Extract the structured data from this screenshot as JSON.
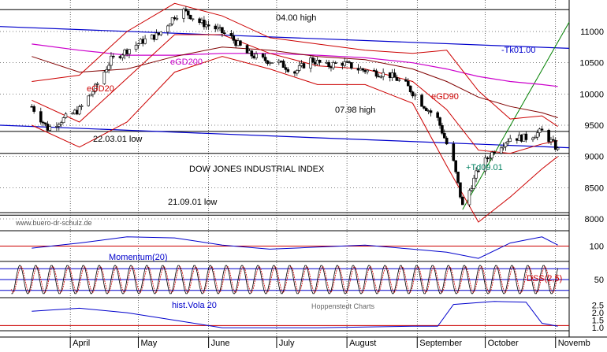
{
  "chart_data": {
    "type": "line",
    "title": "DOW JONES INDUSTRIAL INDEX",
    "watermark": "www.buero-dr-schulz.de",
    "source": "Hoppenstedt Charts",
    "x_labels": [
      "April",
      "May",
      "June",
      "July",
      "August",
      "September",
      "October",
      "Novemb"
    ],
    "price_panel": {
      "ylim": [
        7950,
        11400
      ],
      "yticks": [
        8000,
        8500,
        9000,
        9500,
        10000,
        10500,
        11000
      ],
      "horizontal_lines": [
        {
          "label": "04.00 high",
          "value": 11350
        },
        {
          "label": "07.98 high",
          "value": 9400
        },
        {
          "label": "22.03.01 low",
          "value": 9050
        },
        {
          "label": "21.09.01 low",
          "value": 8060
        }
      ],
      "overlay_labels": {
        "egd20": "eGD20",
        "egd200": "eGD200",
        "egd90": "eGD90",
        "tk": "-Tk01.00",
        "td": "+Td09.01"
      },
      "close": [
        {
          "d": "2001-03-15",
          "v": 9800
        },
        {
          "d": "2001-03-22",
          "v": 9450
        },
        {
          "d": "2001-03-29",
          "v": 9600
        },
        {
          "d": "2001-04-05",
          "v": 9750
        },
        {
          "d": "2001-04-12",
          "v": 10100
        },
        {
          "d": "2001-04-19",
          "v": 10550
        },
        {
          "d": "2001-04-26",
          "v": 10700
        },
        {
          "d": "2001-05-03",
          "v": 10850
        },
        {
          "d": "2001-05-10",
          "v": 10950
        },
        {
          "d": "2001-05-17",
          "v": 11250
        },
        {
          "d": "2001-05-21",
          "v": 11330
        },
        {
          "d": "2001-05-28",
          "v": 11150
        },
        {
          "d": "2001-06-04",
          "v": 11050
        },
        {
          "d": "2001-06-11",
          "v": 10900
        },
        {
          "d": "2001-06-18",
          "v": 10650
        },
        {
          "d": "2001-06-25",
          "v": 10550
        },
        {
          "d": "2001-07-02",
          "v": 10500
        },
        {
          "d": "2001-07-09",
          "v": 10350
        },
        {
          "d": "2001-07-16",
          "v": 10550
        },
        {
          "d": "2001-07-23",
          "v": 10450
        },
        {
          "d": "2001-07-30",
          "v": 10500
        },
        {
          "d": "2001-08-06",
          "v": 10400
        },
        {
          "d": "2001-08-13",
          "v": 10350
        },
        {
          "d": "2001-08-20",
          "v": 10300
        },
        {
          "d": "2001-08-27",
          "v": 10150
        },
        {
          "d": "2001-09-03",
          "v": 9850
        },
        {
          "d": "2001-09-10",
          "v": 9600
        },
        {
          "d": "2001-09-17",
          "v": 8900
        },
        {
          "d": "2001-09-21",
          "v": 8200
        },
        {
          "d": "2001-09-28",
          "v": 8800
        },
        {
          "d": "2001-10-05",
          "v": 9100
        },
        {
          "d": "2001-10-12",
          "v": 9300
        },
        {
          "d": "2001-10-19",
          "v": 9300
        },
        {
          "d": "2001-10-26",
          "v": 9400
        },
        {
          "d": "2001-10-31",
          "v": 9200
        },
        {
          "d": "2001-11-02",
          "v": 9100
        }
      ],
      "egd20": [
        {
          "d": "2001-03-15",
          "v": 9900
        },
        {
          "d": "2001-04-05",
          "v": 9550
        },
        {
          "d": "2001-04-26",
          "v": 10250
        },
        {
          "d": "2001-05-17",
          "v": 10950
        },
        {
          "d": "2001-06-07",
          "v": 10950
        },
        {
          "d": "2001-06-28",
          "v": 10650
        },
        {
          "d": "2001-07-19",
          "v": 10450
        },
        {
          "d": "2001-08-09",
          "v": 10400
        },
        {
          "d": "2001-08-30",
          "v": 10200
        },
        {
          "d": "2001-09-14",
          "v": 9750
        },
        {
          "d": "2001-09-28",
          "v": 9100
        },
        {
          "d": "2001-10-12",
          "v": 9050
        },
        {
          "d": "2001-10-26",
          "v": 9200
        },
        {
          "d": "2001-11-02",
          "v": 9250
        }
      ],
      "egd90": [
        {
          "d": "2001-03-15",
          "v": 10600
        },
        {
          "d": "2001-04-05",
          "v": 10350
        },
        {
          "d": "2001-04-26",
          "v": 10400
        },
        {
          "d": "2001-05-17",
          "v": 10600
        },
        {
          "d": "2001-06-07",
          "v": 10750
        },
        {
          "d": "2001-06-28",
          "v": 10700
        },
        {
          "d": "2001-07-19",
          "v": 10600
        },
        {
          "d": "2001-08-09",
          "v": 10550
        },
        {
          "d": "2001-08-30",
          "v": 10400
        },
        {
          "d": "2001-09-14",
          "v": 10200
        },
        {
          "d": "2001-09-28",
          "v": 9950
        },
        {
          "d": "2001-10-12",
          "v": 9800
        },
        {
          "d": "2001-10-26",
          "v": 9700
        },
        {
          "d": "2001-11-02",
          "v": 9620
        }
      ],
      "egd200": [
        {
          "d": "2001-03-15",
          "v": 10800
        },
        {
          "d": "2001-04-05",
          "v": 10700
        },
        {
          "d": "2001-04-26",
          "v": 10620
        },
        {
          "d": "2001-05-17",
          "v": 10620
        },
        {
          "d": "2001-06-07",
          "v": 10650
        },
        {
          "d": "2001-06-28",
          "v": 10650
        },
        {
          "d": "2001-07-19",
          "v": 10620
        },
        {
          "d": "2001-08-09",
          "v": 10580
        },
        {
          "d": "2001-08-30",
          "v": 10500
        },
        {
          "d": "2001-09-14",
          "v": 10400
        },
        {
          "d": "2001-09-28",
          "v": 10280
        },
        {
          "d": "2001-10-12",
          "v": 10200
        },
        {
          "d": "2001-10-26",
          "v": 10150
        },
        {
          "d": "2001-11-02",
          "v": 10120
        }
      ],
      "bb_upper": [
        {
          "d": "2001-03-15",
          "v": 10200
        },
        {
          "d": "2001-04-05",
          "v": 10300
        },
        {
          "d": "2001-04-26",
          "v": 11000
        },
        {
          "d": "2001-05-17",
          "v": 11450
        },
        {
          "d": "2001-06-07",
          "v": 11250
        },
        {
          "d": "2001-06-28",
          "v": 10900
        },
        {
          "d": "2001-07-19",
          "v": 10800
        },
        {
          "d": "2001-08-09",
          "v": 10700
        },
        {
          "d": "2001-08-30",
          "v": 10650
        },
        {
          "d": "2001-09-14",
          "v": 10700
        },
        {
          "d": "2001-09-28",
          "v": 10050
        },
        {
          "d": "2001-10-12",
          "v": 9600
        },
        {
          "d": "2001-10-26",
          "v": 9650
        },
        {
          "d": "2001-11-02",
          "v": 9480
        }
      ],
      "bb_lower": [
        {
          "d": "2001-03-15",
          "v": 9500
        },
        {
          "d": "2001-04-05",
          "v": 9150
        },
        {
          "d": "2001-04-26",
          "v": 9550
        },
        {
          "d": "2001-05-17",
          "v": 10350
        },
        {
          "d": "2001-06-07",
          "v": 10600
        },
        {
          "d": "2001-06-28",
          "v": 10400
        },
        {
          "d": "2001-07-19",
          "v": 10150
        },
        {
          "d": "2001-08-09",
          "v": 10150
        },
        {
          "d": "2001-08-30",
          "v": 9850
        },
        {
          "d": "2001-09-14",
          "v": 8850
        },
        {
          "d": "2001-09-28",
          "v": 7950
        },
        {
          "d": "2001-10-12",
          "v": 8350
        },
        {
          "d": "2001-10-26",
          "v": 8800
        },
        {
          "d": "2001-11-02",
          "v": 9000
        }
      ],
      "tk_line": [
        {
          "d": "2001-03-01",
          "v": 11080
        },
        {
          "d": "2001-11-07",
          "v": 10730
        }
      ],
      "blue_trend": [
        {
          "d": "2001-03-01",
          "v": 9500
        },
        {
          "d": "2001-11-07",
          "v": 9140
        }
      ],
      "td_line": [
        {
          "d": "2001-09-21",
          "v": 8150
        },
        {
          "d": "2001-11-07",
          "v": 11150
        }
      ]
    },
    "momentum_panel": {
      "label": "Momentum(20)",
      "ytick": 100,
      "ylim": [
        85,
        115
      ],
      "series": [
        {
          "d": "2001-03-15",
          "v": 98
        },
        {
          "d": "2001-04-05",
          "v": 103
        },
        {
          "d": "2001-04-26",
          "v": 109
        },
        {
          "d": "2001-05-17",
          "v": 108
        },
        {
          "d": "2001-06-07",
          "v": 101
        },
        {
          "d": "2001-06-28",
          "v": 97
        },
        {
          "d": "2001-07-19",
          "v": 99
        },
        {
          "d": "2001-08-09",
          "v": 101
        },
        {
          "d": "2001-08-30",
          "v": 97
        },
        {
          "d": "2001-09-14",
          "v": 94
        },
        {
          "d": "2001-09-28",
          "v": 88
        },
        {
          "d": "2001-10-12",
          "v": 103
        },
        {
          "d": "2001-10-26",
          "v": 109
        },
        {
          "d": "2001-11-02",
          "v": 101
        }
      ]
    },
    "dss_panel": {
      "label": "DSS(2,5)",
      "ytick": 50,
      "ylim": [
        0,
        100
      ],
      "bands": [
        20,
        50,
        80
      ],
      "oscillation_days": 7,
      "amplitude": 40
    },
    "vola_panel": {
      "label": "hist.Vola 20",
      "yticks": [
        1.0,
        1.5,
        2.0,
        2.5
      ],
      "ylim": [
        0.8,
        3.0
      ],
      "baseline": 1.15,
      "series": [
        {
          "d": "2001-03-15",
          "v": 2.1
        },
        {
          "d": "2001-04-05",
          "v": 2.3
        },
        {
          "d": "2001-04-26",
          "v": 2.0
        },
        {
          "d": "2001-05-17",
          "v": 1.5
        },
        {
          "d": "2001-06-07",
          "v": 1.0
        },
        {
          "d": "2001-06-28",
          "v": 1.0
        },
        {
          "d": "2001-07-19",
          "v": 1.0
        },
        {
          "d": "2001-08-09",
          "v": 1.05
        },
        {
          "d": "2001-08-30",
          "v": 1.1
        },
        {
          "d": "2001-09-10",
          "v": 1.1
        },
        {
          "d": "2001-09-17",
          "v": 2.55
        },
        {
          "d": "2001-10-05",
          "v": 2.75
        },
        {
          "d": "2001-10-19",
          "v": 2.7
        },
        {
          "d": "2001-10-26",
          "v": 1.3
        },
        {
          "d": "2001-11-02",
          "v": 1.1
        }
      ]
    }
  }
}
